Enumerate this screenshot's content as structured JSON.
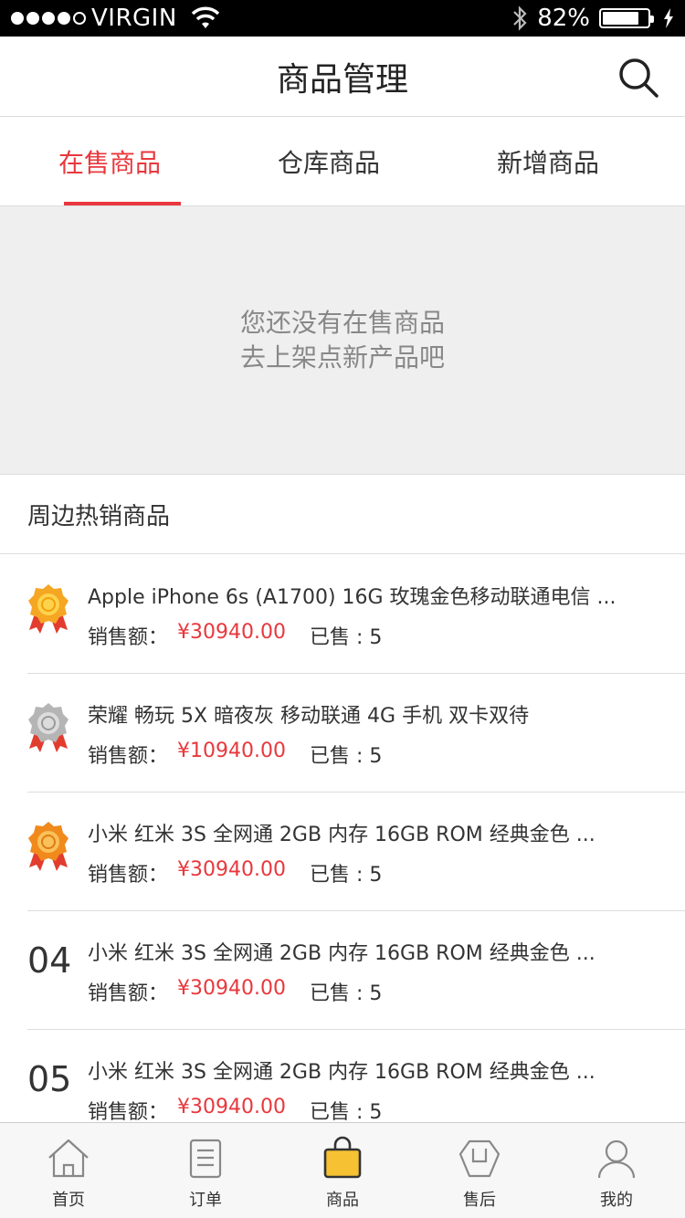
{
  "status_bar": {
    "carrier": "VIRGIN",
    "battery": "82%",
    "battery_level": 0.82
  },
  "navbar": {
    "title": "商品管理"
  },
  "tabs": [
    {
      "label": "在售商品",
      "active": true
    },
    {
      "label": "仓库商品",
      "active": false
    },
    {
      "label": "新增商品",
      "active": false
    }
  ],
  "empty_state": {
    "line1": "您还没有在售商品",
    "line2": "去上架点新产品吧"
  },
  "section": {
    "title": "周边热销商品"
  },
  "labels": {
    "sales_label": "销售额：",
    "sold_label": "已售 : "
  },
  "items": [
    {
      "rank": "1",
      "badge": "gold-medal-icon",
      "title": "Apple iPhone 6s (A1700) 16G 玫瑰金色移动联通电信 ...",
      "price": "¥30940.00",
      "sold": "5"
    },
    {
      "rank": "2",
      "badge": "silver-medal-icon",
      "title": "荣耀 畅玩 5X 暗夜灰 移动联通 4G 手机 双卡双待",
      "price": "¥10940.00",
      "sold": "5"
    },
    {
      "rank": "3",
      "badge": "bronze-medal-icon",
      "title": "小米 红米 3S 全网通 2GB 内存 16GB ROM 经典金色 ...",
      "price": "¥30940.00",
      "sold": "5"
    },
    {
      "rank": "04",
      "badge": "",
      "title": "小米 红米 3S 全网通 2GB 内存 16GB ROM 经典金色 ...",
      "price": "¥30940.00",
      "sold": "5"
    },
    {
      "rank": "05",
      "badge": "",
      "title": "小米 红米 3S 全网通 2GB 内存 16GB ROM 经典金色 ...",
      "price": "¥30940.00",
      "sold": "5"
    }
  ],
  "tabbar": [
    {
      "label": "首页",
      "icon": "home-icon",
      "active": false
    },
    {
      "label": "订单",
      "icon": "order-icon",
      "active": false
    },
    {
      "label": "商品",
      "icon": "bag-icon",
      "active": true
    },
    {
      "label": "售后",
      "icon": "after-sales-icon",
      "active": false
    },
    {
      "label": "我的",
      "icon": "user-icon",
      "active": false
    }
  ],
  "colors": {
    "accent": "#e8383d",
    "tab_active_icon": "#f6c233"
  }
}
